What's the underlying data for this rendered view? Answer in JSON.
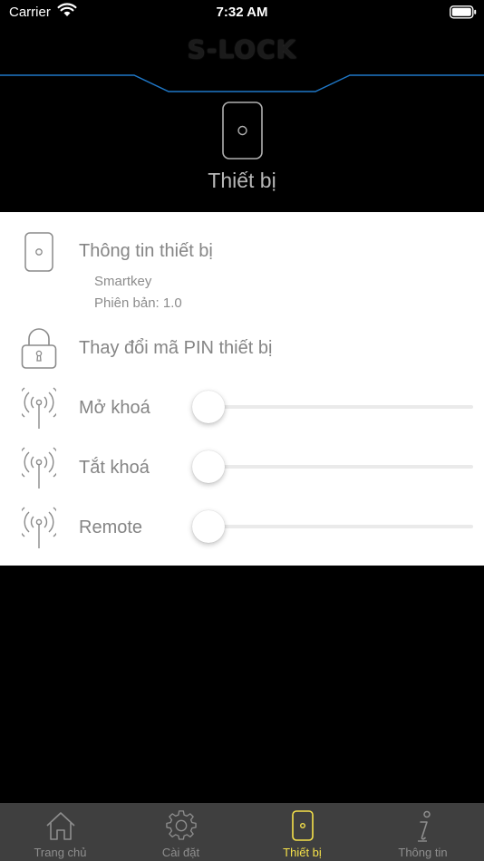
{
  "status_bar": {
    "carrier": "Carrier",
    "time": "7:32 AM"
  },
  "brand": {
    "logo_text": "S-LOCK"
  },
  "header": {
    "title": "Thiết bị",
    "icon": "phone-device-icon"
  },
  "device_info": {
    "label": "Thông tin thiết bị",
    "icon": "phone-device-icon",
    "model": "Smartkey",
    "version": "Phiên bản: 1.0"
  },
  "change_pin": {
    "label": "Thay đổi mã PIN thiết bị",
    "icon": "padlock-icon"
  },
  "slider_rows": [
    {
      "label": "Mở khoá",
      "icon": "antenna-icon",
      "value": 0
    },
    {
      "label": "Tắt khoá",
      "icon": "antenna-icon",
      "value": 0
    },
    {
      "label": "Remote",
      "icon": "antenna-icon",
      "value": 0
    }
  ],
  "tab_bar": {
    "tabs": [
      {
        "label": "Trang chủ",
        "icon": "home-icon",
        "active": false
      },
      {
        "label": "Cài đặt",
        "icon": "gear-icon",
        "active": false
      },
      {
        "label": "Thiết bị",
        "icon": "phone-device-icon",
        "active": true
      },
      {
        "label": "Thông tin",
        "icon": "info-icon",
        "active": false
      }
    ]
  },
  "colors": {
    "active_tab": "#f5e14a",
    "header_line": "#1f78c8",
    "tab_bar_bg": "#3f3f3f"
  }
}
